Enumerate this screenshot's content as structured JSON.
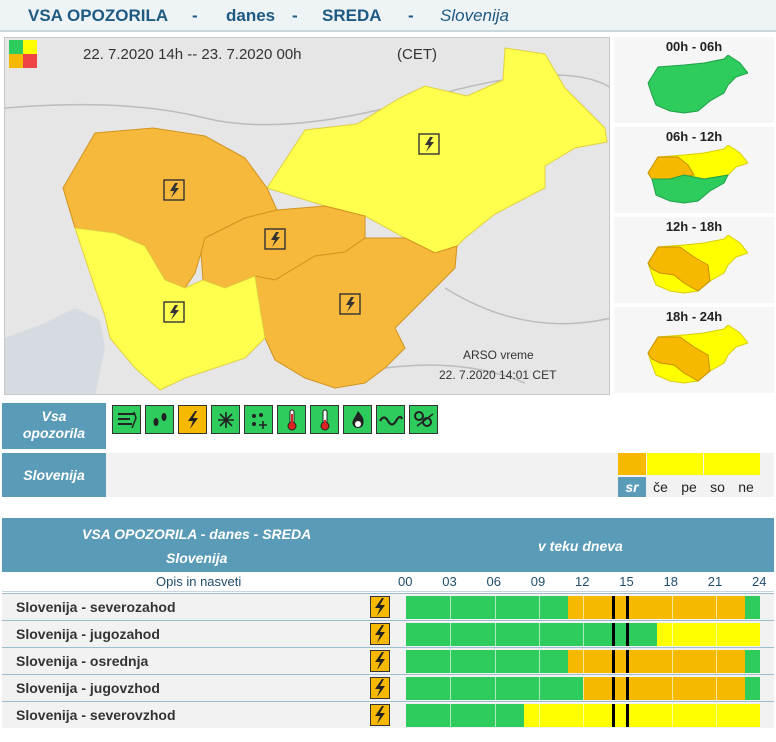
{
  "header": {
    "part1": "VSA OPOZORILA",
    "sep1": "-",
    "part2": "danes",
    "sep2": "-",
    "part3": "SREDA",
    "sep3": "-",
    "part4": "Slovenija"
  },
  "map": {
    "period": "22. 7.2020 14h -- 23. 7.2020 00h",
    "tz": "(CET)",
    "credit": "ARSO vreme",
    "stamp": "22. 7.2020  14:01 CET"
  },
  "colors": {
    "green": "#2ecc5c",
    "orange": "#f6b900",
    "yellow": "#ffff00",
    "blue": "#5a9bb8"
  },
  "side_maps": [
    {
      "label": "00h - 06h",
      "state": "green"
    },
    {
      "label": "06h - 12h",
      "state": "mixed-green"
    },
    {
      "label": "12h - 18h",
      "state": "orange-yellow"
    },
    {
      "label": "18h - 24h",
      "state": "orange-yellow"
    }
  ],
  "icons_row": {
    "label_line1": "Vsa",
    "label_line2": "opozorila",
    "icons": [
      "wind-icon",
      "rain-icon",
      "thunderstorm-icon",
      "snow-icon",
      "snow-rain-icon",
      "high-temperature-icon",
      "low-temperature-icon",
      "fire-icon",
      "coastal-icon",
      "avalanche-icon"
    ],
    "selected": "thunderstorm-icon"
  },
  "region_row": {
    "label": "Slovenija",
    "days": [
      "sr",
      "če",
      "pe",
      "so",
      "ne"
    ]
  },
  "table": {
    "title": "VSA OPOZORILA - danes - SREDA",
    "subtitle": "Slovenija",
    "timeline_title": "v teku dneva",
    "desc_header": "Opis in nasveti",
    "hours": [
      "00",
      "03",
      "06",
      "09",
      "12",
      "15",
      "18",
      "21",
      "24"
    ],
    "rows": [
      {
        "name": "Slovenija - severozahod",
        "segments": [
          {
            "c": "green",
            "from": 0,
            "to": 11
          },
          {
            "c": "orange",
            "from": 11,
            "to": 23
          },
          {
            "c": "green",
            "from": 23,
            "to": 24
          }
        ]
      },
      {
        "name": "Slovenija - jugozahod",
        "segments": [
          {
            "c": "green",
            "from": 0,
            "to": 17
          },
          {
            "c": "yellow",
            "from": 17,
            "to": 24
          }
        ]
      },
      {
        "name": "Slovenija - osrednja",
        "segments": [
          {
            "c": "green",
            "from": 0,
            "to": 11
          },
          {
            "c": "orange",
            "from": 11,
            "to": 23
          },
          {
            "c": "green",
            "from": 23,
            "to": 24
          }
        ]
      },
      {
        "name": "Slovenija - jugovzhod",
        "segments": [
          {
            "c": "green",
            "from": 0,
            "to": 12
          },
          {
            "c": "orange",
            "from": 12,
            "to": 23
          },
          {
            "c": "green",
            "from": 23,
            "to": 24
          }
        ]
      },
      {
        "name": "Slovenija - severovzhod",
        "segments": [
          {
            "c": "green",
            "from": 0,
            "to": 8
          },
          {
            "c": "yellow",
            "from": 8,
            "to": 24
          }
        ]
      }
    ]
  }
}
